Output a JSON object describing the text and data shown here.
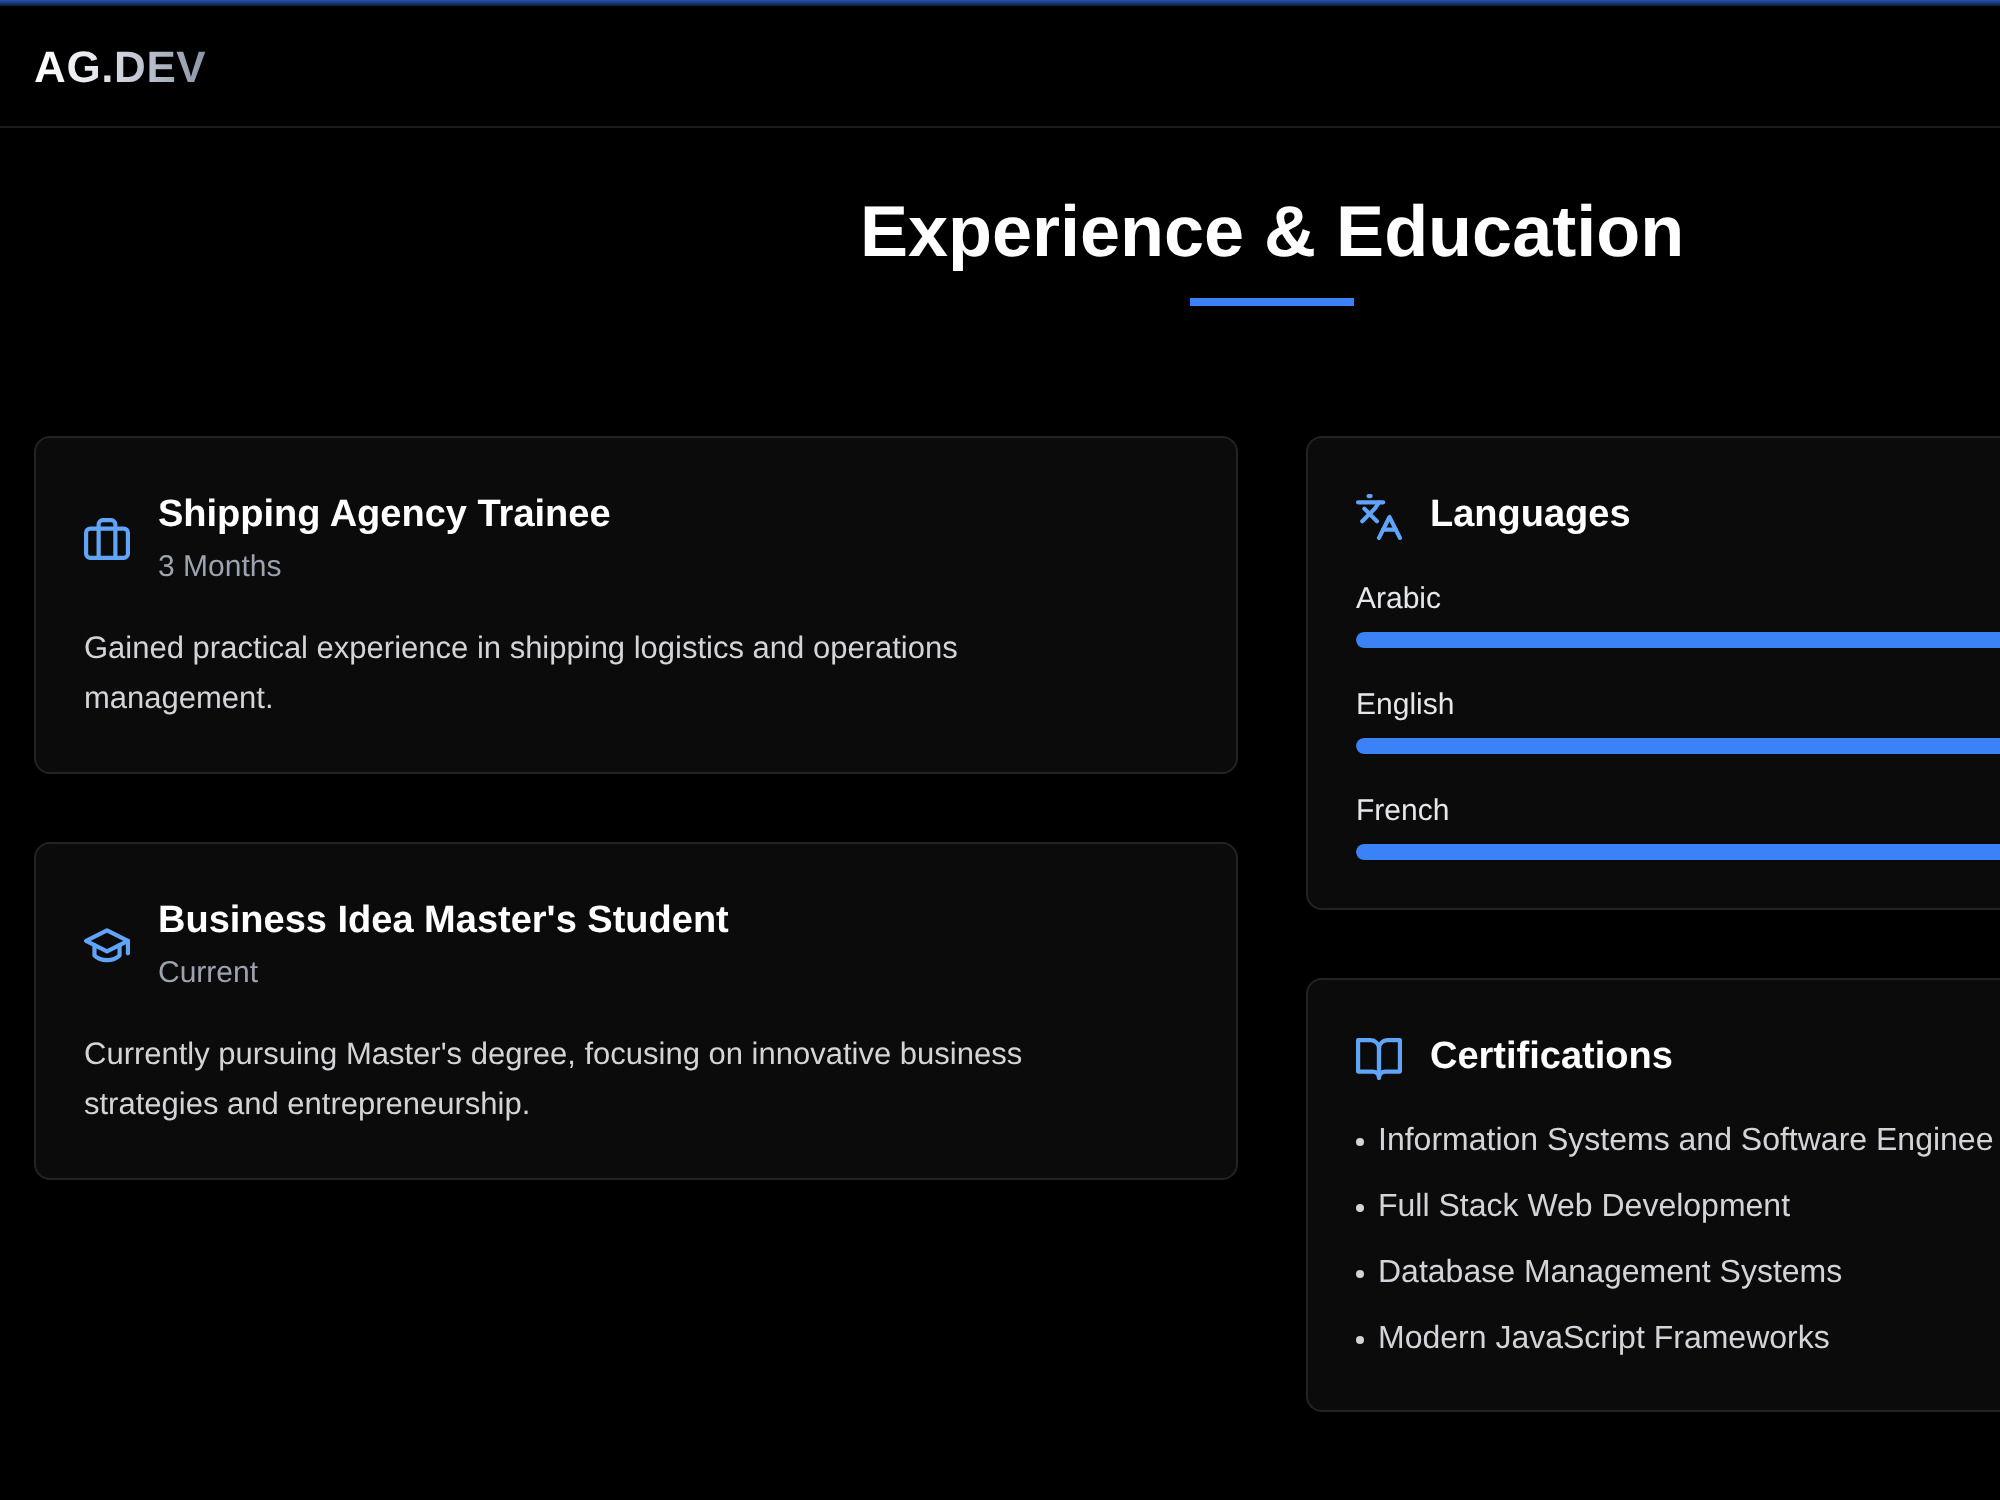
{
  "navbar": {
    "brand": "AG.DEV"
  },
  "section": {
    "title": "Experience & Education"
  },
  "experience": [
    {
      "kind": "work",
      "title": "Shipping Agency Trainee",
      "period": "3 Months",
      "description": "Gained practical experience in shipping logistics and operations management."
    },
    {
      "kind": "education",
      "title": "Business Idea Master's Student",
      "period": "Current",
      "description": "Currently pursuing Master's degree, focusing on innovative business strategies and entrepreneurship."
    }
  ],
  "languages": {
    "title": "Languages",
    "items": [
      {
        "name": "Arabic",
        "level": 1
      },
      {
        "name": "English",
        "level": 1
      },
      {
        "name": "French",
        "level": 1
      }
    ]
  },
  "certifications": {
    "title": "Certifications",
    "items": [
      "Information Systems and Software Enginee",
      "Full Stack Web Development",
      "Database Management Systems",
      "Modern JavaScript Frameworks"
    ]
  }
}
